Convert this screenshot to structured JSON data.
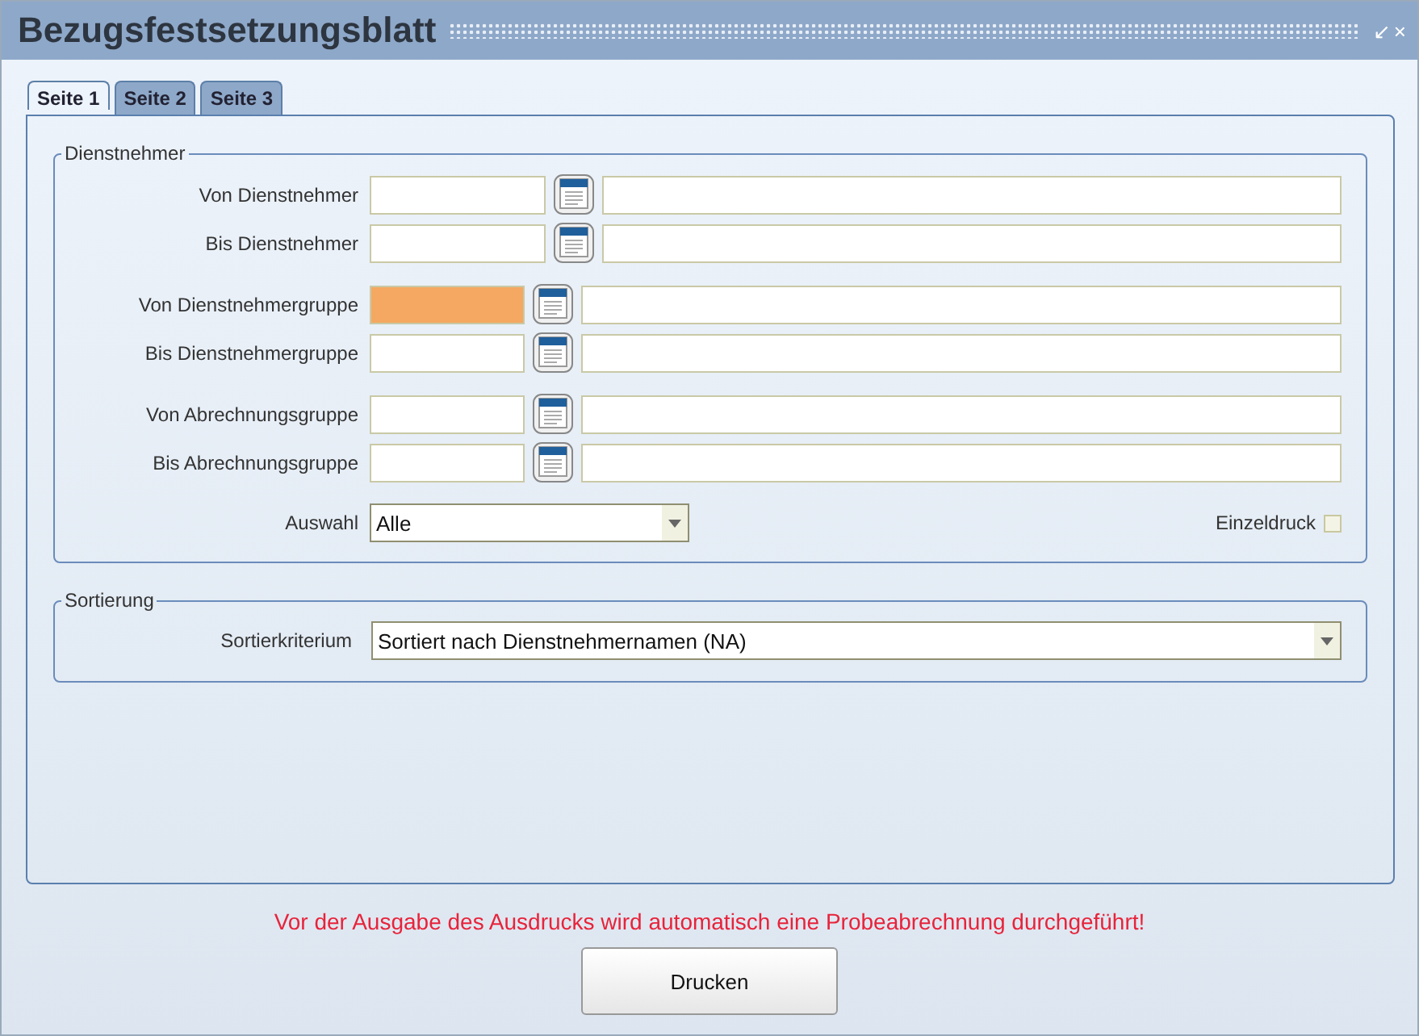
{
  "window": {
    "title": "Bezugsfestsetzungsblatt",
    "buttons": [
      "↙",
      "×"
    ]
  },
  "tabs": [
    {
      "label": "Seite 1",
      "selected": true
    },
    {
      "label": "Seite 2",
      "selected": false
    },
    {
      "label": "Seite 3",
      "selected": false
    }
  ],
  "dienstnehmer": {
    "legend": "Dienstnehmer",
    "field_groups": [
      [
        {
          "label": "Von Dienstnehmer",
          "focused": false
        },
        {
          "label": "Bis Dienstnehmer",
          "focused": false
        }
      ],
      [
        {
          "label": "Von Dienstnehmergruppe",
          "focused": true
        },
        {
          "label": "Bis Dienstnehmergruppe",
          "focused": false
        }
      ],
      [
        {
          "label": "Von Abrechnungsgruppe",
          "focused": false
        },
        {
          "label": "Bis Abrechnungsgruppe",
          "focused": false
        }
      ]
    ],
    "auswahl": {
      "label": "Auswahl",
      "value": "Alle"
    },
    "einzeldruck": {
      "label": "Einzeldruck",
      "checked": false
    }
  },
  "sortierung": {
    "legend": "Sortierung",
    "label": "Sortierkriterium",
    "value": "Sortiert nach Dienstnehmernamen (NA)"
  },
  "message": "Vor der Ausgabe des Ausdrucks wird automatisch eine Probeabrechnung durchgeführt!",
  "print_button": "Drucken"
}
